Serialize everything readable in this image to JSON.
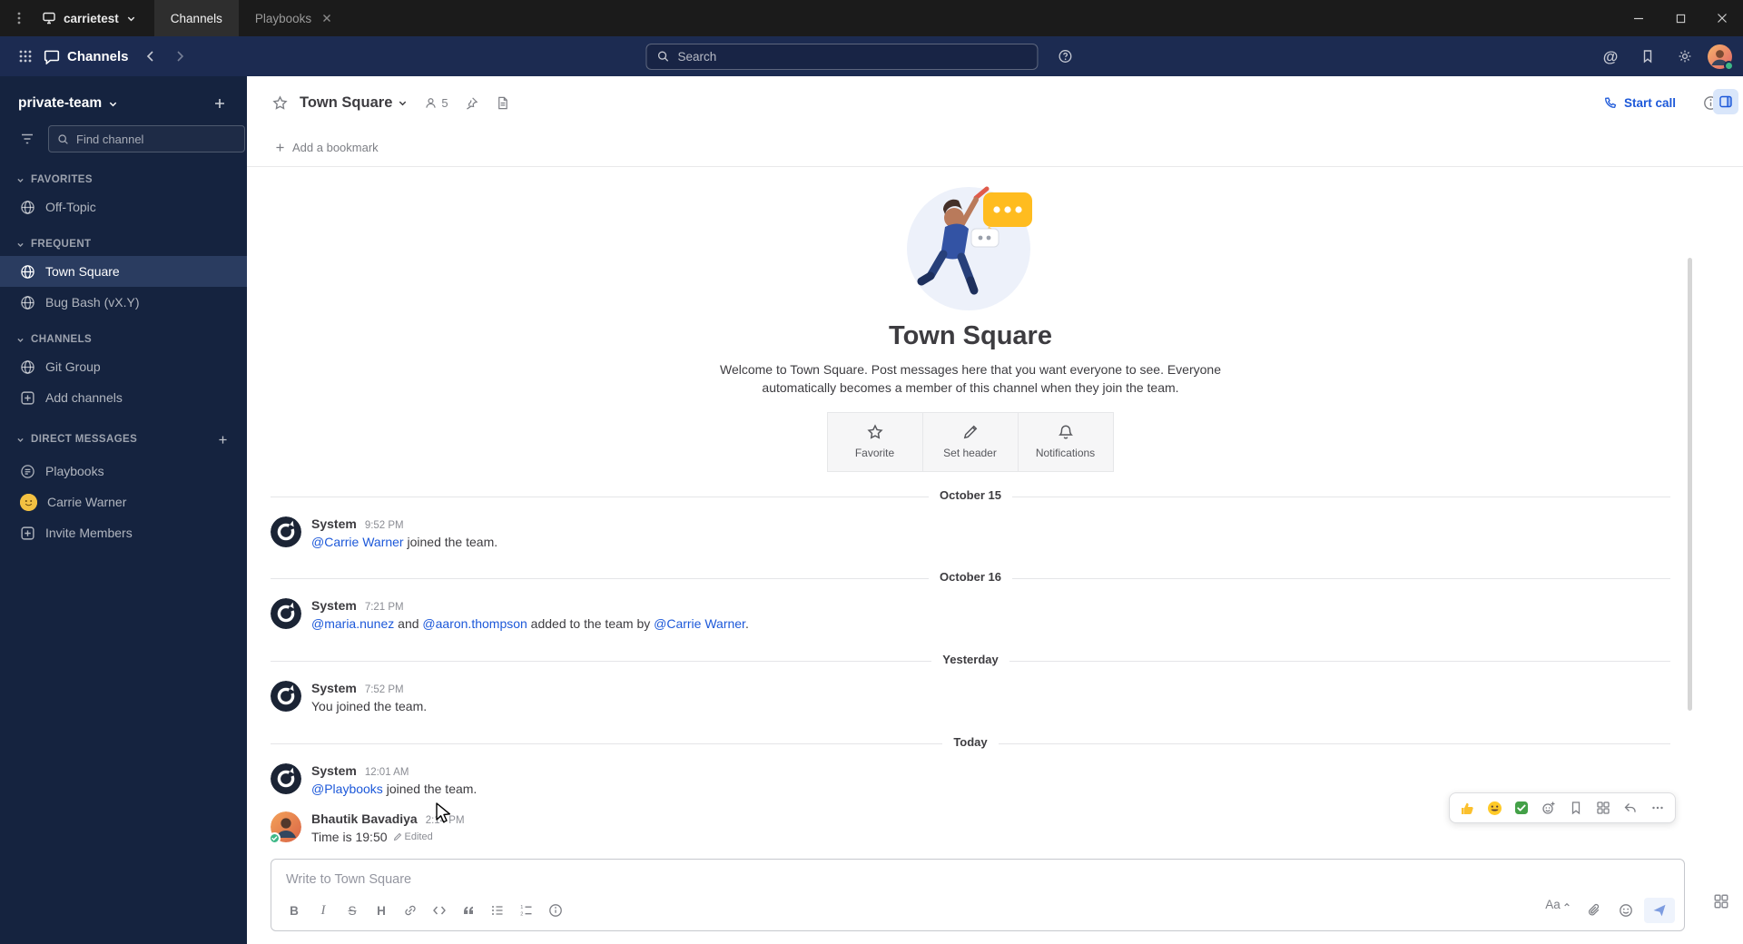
{
  "titlebar": {
    "server_name": "carrietest",
    "tabs": [
      {
        "label": "Channels"
      },
      {
        "label": "Playbooks"
      }
    ]
  },
  "global_header": {
    "product_name": "Channels",
    "search_placeholder": "Search"
  },
  "sidebar": {
    "team_name": "private-team",
    "find_channel_placeholder": "Find channel",
    "sections": [
      {
        "label": "FAVORITES",
        "items": [
          {
            "label": "Off-Topic"
          }
        ]
      },
      {
        "label": "FREQUENT",
        "items": [
          {
            "label": "Town Square"
          },
          {
            "label": "Bug Bash (vX.Y)"
          }
        ]
      },
      {
        "label": "CHANNELS",
        "items": [
          {
            "label": "Git Group"
          },
          {
            "label": "Add channels"
          }
        ]
      },
      {
        "label": "DIRECT MESSAGES",
        "items": [
          {
            "label": "Playbooks"
          },
          {
            "label": "Carrie Warner"
          },
          {
            "label": "Invite Members"
          }
        ]
      }
    ]
  },
  "channel_header": {
    "title": "Town Square",
    "member_count": "5",
    "start_call_label": "Start call",
    "add_bookmark_label": "Add a bookmark"
  },
  "intro": {
    "title": "Town Square",
    "description": "Welcome to Town Square. Post messages here that you want everyone to see. Everyone automatically becomes a member of this channel when they join the team.",
    "actions": [
      {
        "label": "Favorite"
      },
      {
        "label": "Set header"
      },
      {
        "label": "Notifications"
      }
    ]
  },
  "messages": [
    {
      "type": "divider",
      "label": "October 15"
    },
    {
      "type": "system",
      "sender": "System",
      "time": "9:52 PM",
      "parts": [
        {
          "kind": "mention",
          "text": "@Carrie Warner"
        },
        {
          "kind": "text",
          "text": " joined the team."
        }
      ]
    },
    {
      "type": "divider",
      "label": "October 16"
    },
    {
      "type": "system",
      "sender": "System",
      "time": "7:21 PM",
      "parts": [
        {
          "kind": "mention",
          "text": "@maria.nunez"
        },
        {
          "kind": "text",
          "text": " and "
        },
        {
          "kind": "mention",
          "text": "@aaron.thompson"
        },
        {
          "kind": "text",
          "text": " added to the team by "
        },
        {
          "kind": "mention",
          "text": "@Carrie Warner"
        },
        {
          "kind": "text",
          "text": "."
        }
      ]
    },
    {
      "type": "divider",
      "label": "Yesterday"
    },
    {
      "type": "system",
      "sender": "System",
      "time": "7:52 PM",
      "parts": [
        {
          "kind": "text",
          "text": "You joined the team."
        }
      ]
    },
    {
      "type": "divider",
      "label": "Today"
    },
    {
      "type": "system",
      "sender": "System",
      "time": "12:01 AM",
      "parts": [
        {
          "kind": "mention",
          "text": "@Playbooks"
        },
        {
          "kind": "text",
          "text": " joined the team."
        }
      ]
    },
    {
      "type": "user",
      "sender": "Bhautik Bavadiya",
      "time": "2:14 PM",
      "text": "Time is 19:50",
      "edited_label": "Edited"
    }
  ],
  "message_toolbar": {
    "reactions": [
      "thumbs-up",
      "grinning",
      "white-check-mark"
    ]
  },
  "composer": {
    "placeholder": "Write to Town Square"
  },
  "colors": {
    "accent_blue": "#1c58d9",
    "header_bg": "#1c2b51",
    "sidebar_bg": "#15233f",
    "titlebar_bg": "#1b1b1b",
    "online_green": "#3db887"
  }
}
